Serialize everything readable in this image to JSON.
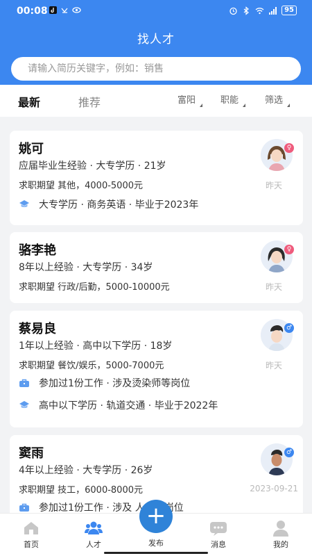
{
  "status_bar": {
    "time": "00:08",
    "battery": "95"
  },
  "header": {
    "title": "找人才"
  },
  "search": {
    "placeholder": "请输入简历关键字，例如：销售"
  },
  "tabs": [
    {
      "label": "最新"
    },
    {
      "label": "推荐"
    }
  ],
  "filters": [
    {
      "label": "富阳"
    },
    {
      "label": "职能"
    },
    {
      "label": "筛选"
    }
  ],
  "candidates": [
    {
      "name": "姚可",
      "meta": "应届毕业生经验 · 大专学历 · 21岁",
      "expect": "求职期望 其他，4000-5000元",
      "education": "大专学历 · 商务英语 · 毕业于2023年",
      "time": "昨天",
      "gender": "♀"
    },
    {
      "name": "骆李艳",
      "meta": "8年以上经验 · 大专学历 · 34岁",
      "expect": "求职期望 行政/后勤，5000-10000元",
      "time": "昨天",
      "gender": "♀"
    },
    {
      "name": "蔡易良",
      "meta": "1年以上经验 · 高中以下学历 · 18岁",
      "expect": "求职期望 餐饮/娱乐，5000-7000元",
      "work": "参加过1份工作 · 涉及烫染师等岗位",
      "education": "高中以下学历 · 轨道交通 · 毕业于2022年",
      "time": "昨天",
      "gender": "♂"
    },
    {
      "name": "窦雨",
      "meta": "4年以上经验 · 大专学历 · 26岁",
      "expect": "求职期望 技工，6000-8000元",
      "work": "参加过1份工作 · 涉及 人员等岗位",
      "time": "2023-09-21",
      "gender": "♂"
    }
  ],
  "tabbar": {
    "home": "首页",
    "talent": "人才",
    "publish": "发布",
    "messages": "消息",
    "mine": "我的",
    "publish_symbol": "+"
  },
  "colors": {
    "primary": "#3c87f0",
    "female": "#ef5b7c",
    "male": "#3c87f0"
  }
}
